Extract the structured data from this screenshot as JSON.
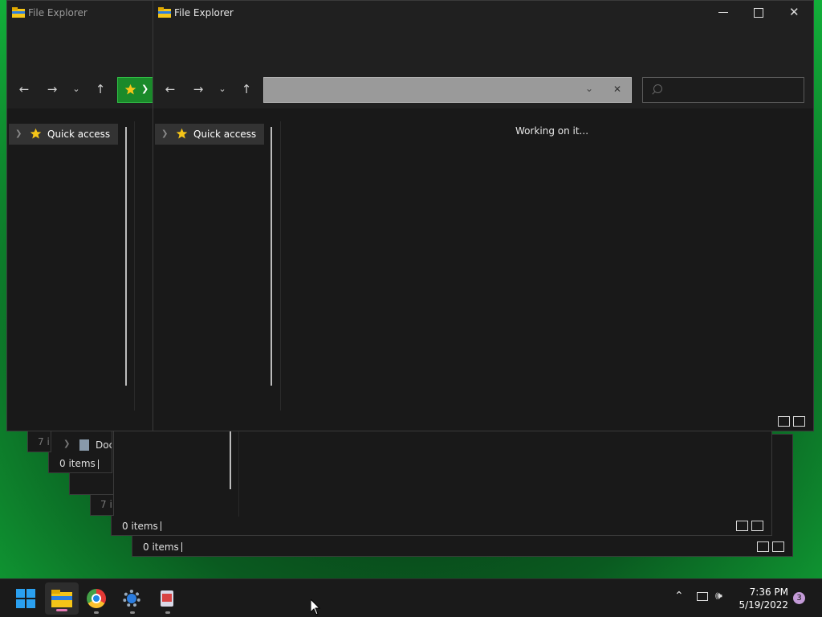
{
  "windows": {
    "title": "File Explorer",
    "quick_access_label": "Quick access",
    "working_text": "Working on it...",
    "items_count": "0 items",
    "items_count_partial": "7 i",
    "items_count_partial2": "7 i",
    "docs_label_partial": "Doc"
  },
  "taskbar": {
    "time": "7:36 PM",
    "date": "5/19/2022",
    "notification_count": "3",
    "apps": [
      "start-icon",
      "file-explorer-icon",
      "chrome-icon",
      "settings-icon",
      "recycle-bin-icon"
    ]
  },
  "colors": {
    "accent_green": "#1a8a2a",
    "folder_yellow": "#f5c518",
    "notification_badge": "#c49bd8"
  }
}
